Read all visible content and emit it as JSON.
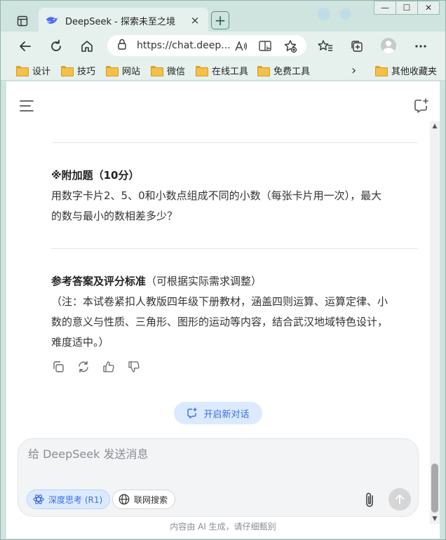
{
  "browser": {
    "tab_title": "DeepSeek - 探索未至之境",
    "tab_close": "×",
    "new_tab": "+",
    "window_controls": {
      "minimize": "—",
      "maximize": "☐",
      "close": "✕"
    },
    "url": "https://chat.deep...",
    "bookmarks": [
      "设计",
      "技巧",
      "网站",
      "微信",
      "在线工具",
      "免费工具"
    ],
    "other_bookmarks": "其他收藏夹",
    "more_chevron": "›"
  },
  "content": {
    "bonus_title": "※附加题（10分）",
    "bonus_line1": "用数字卡片2、5、0和小数点组成不同的小数（每张卡片用一次），最大",
    "bonus_line2": "的数与最小的数相差多少？",
    "answer_title": "参考答案及评分标准",
    "answer_title_suffix": "（可根据实际需求调整）",
    "note_line1": "（注：本试卷紧扣人教版四年级下册教材，涵盖四则运算、运算定律、小",
    "note_line2": "数的意义与性质、三角形、图形的运动等内容，结合武汉地域特色设计，",
    "note_line3": "难度适中。）"
  },
  "new_conversation": "开启新对话",
  "composer": {
    "placeholder": "给 DeepSeek 发送消息",
    "deep_think": "深度思考 (R1)",
    "web_search": "联网搜索"
  },
  "footer": "内容由 AI 生成，请仔细甄别",
  "colors": {
    "accent": "#3d6ee0",
    "chip_bg": "#dbeafe",
    "chrome": "#cfe4df"
  }
}
